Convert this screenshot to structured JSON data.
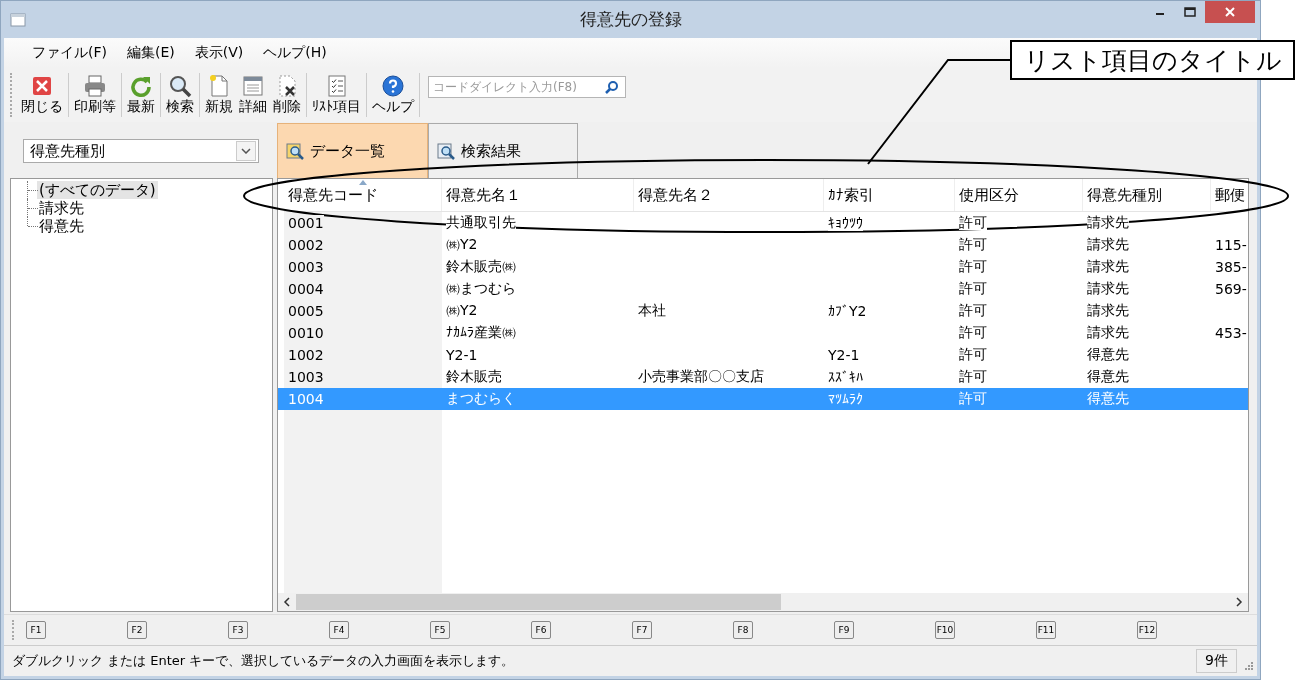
{
  "window": {
    "title": "得意先の登録"
  },
  "menu": [
    "ファイル(F)",
    "編集(E)",
    "表示(V)",
    "ヘルプ(H)"
  ],
  "toolbar": [
    {
      "kind": "close",
      "label": "閉じる"
    },
    {
      "kind": "print",
      "label": "印刷等"
    },
    {
      "kind": "refresh",
      "label": "最新"
    },
    {
      "kind": "search",
      "label": "検索"
    },
    {
      "kind": "new",
      "label": "新規"
    },
    {
      "kind": "detail",
      "label": "詳細"
    },
    {
      "kind": "delete",
      "label": "削除"
    },
    {
      "kind": "list",
      "label": "ﾘｽﾄ項目"
    },
    {
      "kind": "help",
      "label": "ヘルプ"
    }
  ],
  "code_search": {
    "placeholder": "コードダイレクト入力(F8)"
  },
  "category_select": {
    "value": "得意先種別"
  },
  "tabs": [
    {
      "label": "データ一覧",
      "selected": true
    },
    {
      "label": "検索結果",
      "selected": false
    }
  ],
  "tree": [
    {
      "label": "(すべてのデータ)",
      "selected": true
    },
    {
      "label": "請求先",
      "selected": false
    },
    {
      "label": "得意先",
      "selected": false
    }
  ],
  "table": {
    "columns": [
      {
        "label": "得意先コード",
        "sorted": true
      },
      {
        "label": "得意先名１",
        "sorted": false
      },
      {
        "label": "得意先名２",
        "sorted": false
      },
      {
        "label": "ｶﾅ索引",
        "sorted": false
      },
      {
        "label": "使用区分",
        "sorted": false
      },
      {
        "label": "得意先種別",
        "sorted": false
      },
      {
        "label": "郵便",
        "sorted": false
      }
    ],
    "rows": [
      {
        "cells": [
          "0001",
          "共通取引先",
          "",
          "ｷｮｳﾂｳ",
          "許可",
          "請求先",
          ""
        ],
        "selected": false
      },
      {
        "cells": [
          "0002",
          "㈱Y2",
          "",
          "",
          "許可",
          "請求先",
          "115-"
        ],
        "selected": false
      },
      {
        "cells": [
          "0003",
          "鈴木販売㈱",
          "",
          "",
          "許可",
          "請求先",
          "385-"
        ],
        "selected": false
      },
      {
        "cells": [
          "0004",
          "㈱まつむら",
          "",
          "",
          "許可",
          "請求先",
          "569-"
        ],
        "selected": false
      },
      {
        "cells": [
          "0005",
          "㈱Y2",
          "本社",
          "ｶﾌﾞY2",
          "許可",
          "請求先",
          ""
        ],
        "selected": false
      },
      {
        "cells": [
          "0010",
          "ﾅｶﾑﾗ産業㈱",
          "",
          "",
          "許可",
          "請求先",
          "453-"
        ],
        "selected": false
      },
      {
        "cells": [
          "1002",
          "Y2-1",
          "",
          "Y2-1",
          "許可",
          "得意先",
          ""
        ],
        "selected": false
      },
      {
        "cells": [
          "1003",
          "鈴木販売",
          "小売事業部〇〇支店",
          "ｽｽﾞｷﾊ",
          "許可",
          "得意先",
          ""
        ],
        "selected": false
      },
      {
        "cells": [
          "1004",
          "まつむらく",
          "",
          "ﾏﾂﾑﾗｸ",
          "許可",
          "得意先",
          ""
        ],
        "selected": true
      }
    ]
  },
  "function_keys": [
    "F1",
    "F2",
    "F3",
    "F4",
    "F5",
    "F6",
    "F7",
    "F8",
    "F9",
    "F10",
    "F11",
    "F12"
  ],
  "status_bar": {
    "message": "ダブルクリック または Enter キーで、選択しているデータの入力画面を表示します。",
    "count": "9件"
  },
  "callout": {
    "text": "リスト項目のタイトル"
  }
}
